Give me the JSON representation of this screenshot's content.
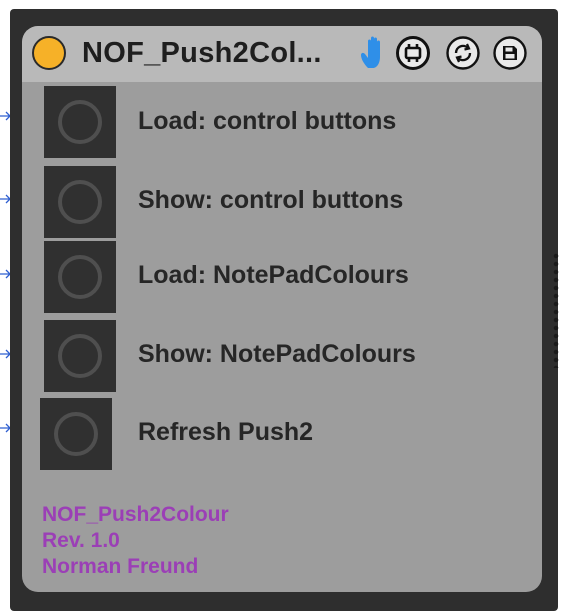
{
  "device": {
    "title": "NOF_Push2Col...",
    "power_color": "#f6b128"
  },
  "titlebar_icons": [
    "hand-icon",
    "map-icon",
    "refresh-icon",
    "save-icon"
  ],
  "buttons": [
    {
      "label": "Load: control buttons"
    },
    {
      "label": "Show: control buttons"
    },
    {
      "label": "Load: NotePadColours"
    },
    {
      "label": "Show: NotePadColours"
    },
    {
      "label": "Refresh Push2"
    }
  ],
  "credits": {
    "name": "NOF_Push2Colour",
    "revision": "Rev. 1.0",
    "author": "Norman Freund",
    "color": "#9b3fb6"
  }
}
